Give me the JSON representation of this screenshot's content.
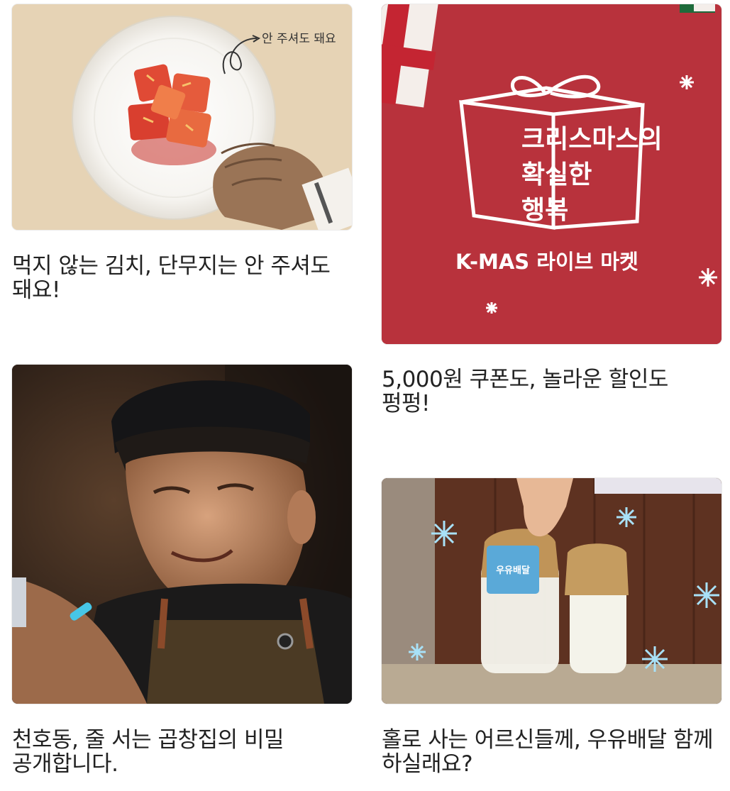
{
  "cards": [
    {
      "caption": "먹지 않는 김치, 단무지는 안 주셔도 돼요!",
      "image_alt": "kimchi plate illustration",
      "note": "안 주셔도 돼요"
    },
    {
      "caption": "5,000원 쿠폰도, 놀라운 할인도 펑펑!",
      "image_alt": "K-MAS live market banner",
      "promo_line1": "크리스마스의",
      "promo_line2": "확실한",
      "promo_line3": "행복",
      "promo_brand": "K-MAS 라이브 마켓",
      "promo_red": "#b8323c"
    },
    {
      "caption": "천호동, 줄 서는 곱창집의 비밀 공개합니다.",
      "image_alt": "man looking at phone in apron"
    },
    {
      "caption": "홀로 사는 어르신들께, 우유배달 함께 하실래요?",
      "image_alt": "milk bottles with snowflakes",
      "bottle_tag": "우유배달"
    }
  ]
}
